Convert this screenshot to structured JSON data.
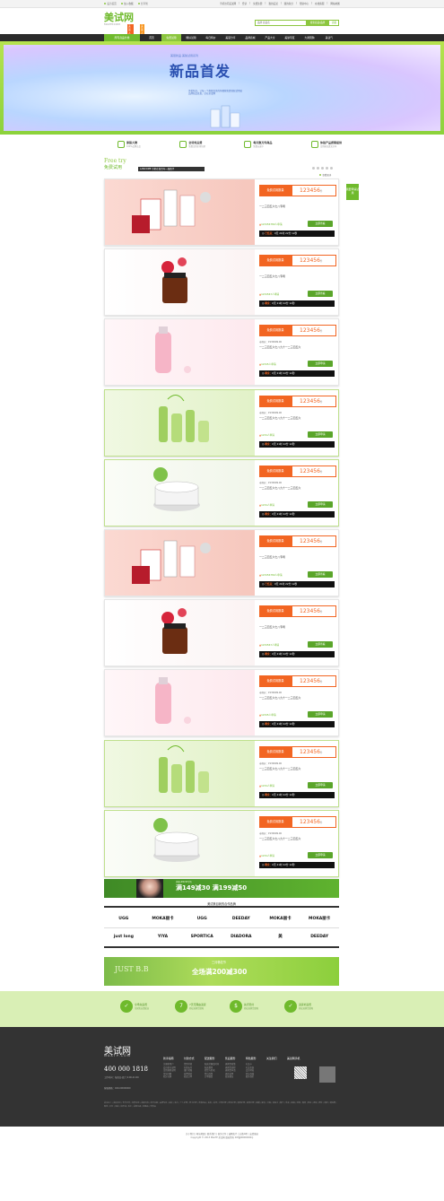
{
  "topbar": {
    "left": [
      "设为首页",
      "加入收藏",
      "分享到"
    ],
    "right": [
      "手机访问美试网",
      "登录",
      "免费注册",
      "我的美试",
      "我的积分",
      "帮助中心",
      "在线客服",
      "网站地图"
    ]
  },
  "logo": {
    "title": "美试网",
    "sub": "MAXTP.COM",
    "badge1": "美丽人生",
    "badge2": "美丽人生"
  },
  "search": {
    "placeholder": "品牌 商品名",
    "button": "搜索商品/品牌",
    "button2": "高级"
  },
  "nav": {
    "category": "所有商品分类",
    "items": [
      "首页",
      "免费试用",
      "爆好试用",
      "每日特价",
      "美丽分享",
      "品牌商城",
      "产品大全",
      "美肤专区",
      "大牌团购",
      "美试气"
    ],
    "active_index": 1
  },
  "banner": {
    "subtitle": "美丽新品·美肤试用系列",
    "headline": "新品首发",
    "desc": "美妆新品，让每一个想要变美的你都能免费领取试用装品牌新品首发，尽在美试网",
    "page_count": 5
  },
  "features": [
    {
      "title": "原装大牌",
      "sub": "100%品牌正品"
    },
    {
      "title": "全场免运费",
      "sub": "免费试用全场包邮"
    },
    {
      "title": "每天数万件商品",
      "sub": "免费派发中"
    },
    {
      "title": "体验产品质尊提供",
      "sub": "试用报告真实分享"
    }
  ],
  "freetry": {
    "en": "Free try",
    "cn": "免费试用",
    "brand_banner": "LANCOME 专柜在售百年一瓶精华"
  },
  "more_link": "查看更多",
  "side_button": "我要申请试用",
  "cards": [
    {
      "theme": "pink",
      "tag": "免费试用数量",
      "value": "123456",
      "unit": "件",
      "old": "",
      "title": "一二三四五六七八专场",
      "price": "123456789",
      "price_unit": "人申请",
      "apply": "立即查看",
      "countdown_label": "已结束：",
      "countdown": "0天 21时 22分 12秒"
    },
    {
      "theme": "rose",
      "tag": "免费试用数量",
      "value": "123456",
      "unit": "件",
      "old": "",
      "title": "一二三四五六七八专场",
      "price": "1234567",
      "price_unit": "人申请",
      "apply": "立即查看",
      "countdown_label": "剩余：",
      "countdown": "0天 21时 22分 12秒"
    },
    {
      "theme": "lightpink",
      "tag": "免费试用数量",
      "value": "123456",
      "unit": "件",
      "old": "市场价：¥139999.00",
      "title": "一二三四五六七八九十一二三四五六",
      "price": "12345",
      "price_unit": "人申请",
      "apply": "立即申请",
      "countdown_label": "剩余：",
      "countdown": "0天 21时 22分 12秒"
    },
    {
      "theme": "green",
      "tag": "免费试用数量",
      "value": "123456",
      "unit": "件",
      "old": "市场价：¥139999.00",
      "title": "一二三四五六七八九十一二三四五六",
      "price": "1234",
      "price_unit": "人申请",
      "apply": "立即申请",
      "countdown_label": "剩余：",
      "countdown": "0天 21时 22分 12秒"
    },
    {
      "theme": "white",
      "tag": "免费试用数量",
      "value": "123456",
      "unit": "件",
      "old": "市场价：¥139999.00",
      "title": "一二三四五六七八九十一二三四五六",
      "price": "1234",
      "price_unit": "人申请",
      "apply": "立即申请",
      "countdown_label": "剩余：",
      "countdown": "0天 21时 22分 12秒"
    },
    {
      "theme": "pink",
      "tag": "免费试用数量",
      "value": "123456",
      "unit": "件",
      "old": "",
      "title": "一二三四五六七八专场",
      "price": "123456789",
      "price_unit": "人申请",
      "apply": "立即查看",
      "countdown_label": "已结束：",
      "countdown": "0天 21时 22分 12秒"
    },
    {
      "theme": "rose",
      "tag": "免费试用数量",
      "value": "123456",
      "unit": "件",
      "old": "",
      "title": "一二三四五六七八专场",
      "price": "1234567",
      "price_unit": "人申请",
      "apply": "立即查看",
      "countdown_label": "剩余：",
      "countdown": "0天 21时 22分 12秒"
    },
    {
      "theme": "lightpink",
      "tag": "免费试用数量",
      "value": "123456",
      "unit": "件",
      "old": "市场价：¥139999.00",
      "title": "一二三四五六七八九十一二三四五六",
      "price": "12345",
      "price_unit": "人申请",
      "apply": "立即申请",
      "countdown_label": "剩余：",
      "countdown": "0天 21时 22分 12秒"
    },
    {
      "theme": "green",
      "tag": "免费试用数量",
      "value": "123456",
      "unit": "件",
      "old": "市场价：¥139999.00",
      "title": "一二三四五六七八九十一二三四五六",
      "price": "1234",
      "price_unit": "人申请",
      "apply": "立即申请",
      "countdown_label": "剩余：",
      "countdown": "0天 21时 22分 12秒"
    },
    {
      "theme": "white",
      "tag": "免费试用数量",
      "value": "123456",
      "unit": "件",
      "old": "市场价：¥139999.00",
      "title": "一二三四五六七八九十一二三四五六",
      "price": "1234",
      "price_unit": "人申请",
      "apply": "立即申请",
      "countdown_label": "剩余：",
      "countdown": "0天 21时 22分 12秒"
    }
  ],
  "promo1": {
    "small": "美肤LIMUSE专场",
    "text": "满149减30 满199减50"
  },
  "brands_title": "美试美目我的合作品牌",
  "brands": [
    "UGG",
    "MOKA丽卡",
    "UGG",
    "DEEDAY",
    "MOKA丽卡",
    "MOKA丽卡",
    "just long",
    "YIYA",
    "SPORTICA",
    "DIADORA",
    "美",
    "DEEDAY"
  ],
  "promo2": {
    "left": "JUST B.B",
    "t1": "三月畅花节",
    "t2": "全场满200减300"
  },
  "guarantees": [
    {
      "icon": "✓",
      "title": "全场免运费",
      "sub": "全国免运费配送"
    },
    {
      "icon": "7",
      "title": "7天无理由退货",
      "sub": "轻松退换货保障"
    },
    {
      "icon": "$",
      "title": "先行赔付",
      "sub": "轻松退换货保障"
    },
    {
      "icon": "✓",
      "title": "退货补运费",
      "sub": "轻松退换货保障"
    }
  ],
  "footer": {
    "logo": "美试网",
    "url": "MAXTP.COM",
    "tel": "400 000 1818",
    "hours": "工作时间：每周日-周六 9:00-21:00",
    "mail": "客服邮箱：020-00000000",
    "columns": [
      {
        "h": "新手指南",
        "items": [
          "注册新用户",
          "会员积分说明",
          "试用规则说明",
          "常见问题",
          "积分兑换"
        ]
      },
      {
        "h": "付款方式",
        "items": [
          "货到付款",
          "在线支付",
          "银行转账",
          "发票制度",
          "修改订单"
        ]
      },
      {
        "h": "配送服务",
        "items": [
          "配送范围及时间",
          "配送费用",
          "验货与签收",
          "售后政策",
          "订单跟踪"
        ]
      },
      {
        "h": "售后服务",
        "items": [
          "退换货政策",
          "退换货流程",
          "退换货申请",
          "退款说明",
          "投诉建议"
        ]
      },
      {
        "h": "特色服务",
        "items": [
          "礼品卡",
          "礼品包装",
          "会员特权",
          "积分商城",
          "联系我们"
        ]
      },
      {
        "h": "关注我们",
        "items": []
      },
      {
        "h": "美试网手机",
        "items": []
      }
    ],
    "links": "美试达人 | 美妆社区 | 合作伙伴 | 免费试用 | 美容百科 | 积分兑换 | 品牌专区 | 彩妆 | 香水 | 个人护理 | 男士护理 | 洗浴用品 | 美发 | 美甲 | 手部护理 | 身体护理 | 眼部护理 | 唇部护理 | 面膜 | 卸妆 | 洁面 | 爽肤水 | 精华 | 乳液 | 面霜 | 防晒 | 隔离 | 粉底 | 遮瑕 | 腮红 | 眼影 | 睫毛膏 | 眼线 | 口红 | 唇彩 | 指甲油 | 香水 | 美容仪器 | 保健品 | 营养品"
  },
  "copyright": {
    "line1": "关于我们 | 网站地图 | 联系我们 | 商务合作 | 诚聘英才 | 法律声明 | 友情链接",
    "line2": "Copyright © 2013 MaxTP 美试网 版权所有  ICP备00000000号"
  },
  "colors": {
    "green": "#6fba2c",
    "orange": "#f26522",
    "dark": "#2b2b2b"
  }
}
